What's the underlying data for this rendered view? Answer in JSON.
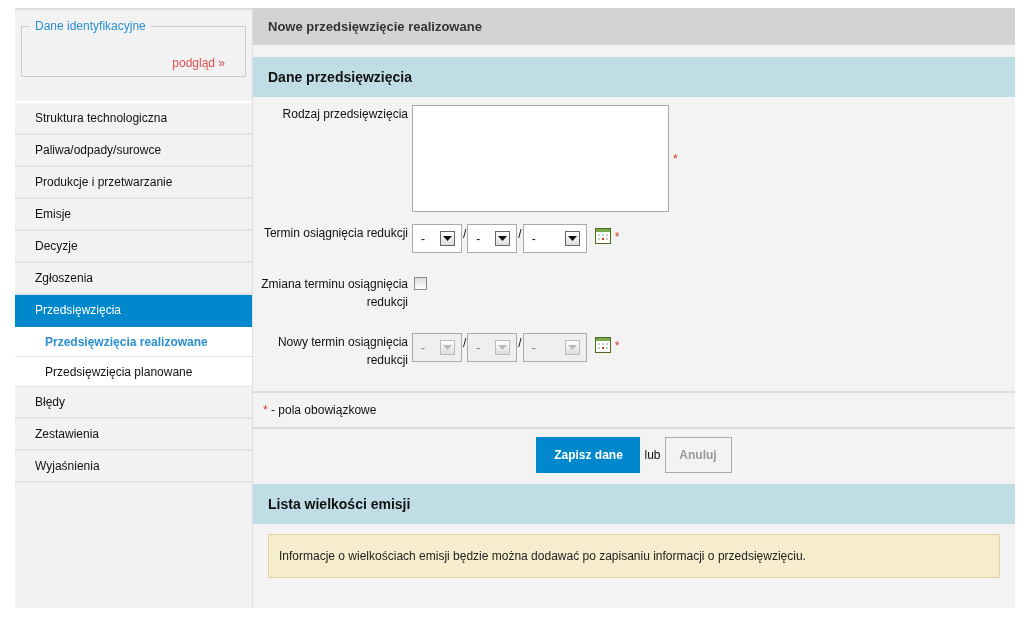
{
  "sidebar": {
    "fieldset": {
      "legend": "Dane identyfikacyjne",
      "link": "podgląd »"
    },
    "items": [
      {
        "label": "Struktura technologiczna",
        "selected": false
      },
      {
        "label": "Paliwa/odpady/surowce",
        "selected": false
      },
      {
        "label": "Produkcje i przetwarzanie",
        "selected": false
      },
      {
        "label": "Emisje",
        "selected": false
      },
      {
        "label": "Decyzje",
        "selected": false
      },
      {
        "label": "Zgłoszenia",
        "selected": false
      },
      {
        "label": "Przedsięwzięcia",
        "selected": true,
        "children": [
          {
            "label": "Przedsięwzięcia realizowane",
            "selected": true
          },
          {
            "label": "Przedsięwzięcia planowane",
            "selected": false
          }
        ]
      },
      {
        "label": "Błędy",
        "selected": false
      },
      {
        "label": "Zestawienia",
        "selected": false
      },
      {
        "label": "Wyjaśnienia",
        "selected": false
      }
    ]
  },
  "page_title": "Nowe przedsięwzięcie realizowane",
  "form_section": {
    "title": "Dane przedsięwzięcia",
    "fields": [
      {
        "kind": "textarea",
        "label": "Rodzaj przedsięwzięcia",
        "required_mark": "*"
      },
      {
        "kind": "date",
        "label": "Termin osiągnięcia redukcji",
        "disabled": false,
        "selects": [
          "-",
          "-",
          "-"
        ],
        "separators": [
          "/",
          "/"
        ],
        "required_mark": "*"
      },
      {
        "kind": "checkbox",
        "label": "Zmiana terminu osiągnięcia redukcji",
        "checked": false
      },
      {
        "kind": "date",
        "label": "Nowy termin osiągnięcia redukcji",
        "disabled": true,
        "selects": [
          "-",
          "-",
          "-"
        ],
        "separators": [
          "/",
          "/"
        ],
        "required_mark": "*"
      }
    ],
    "required_note": {
      "mark": "*",
      "text": "- pola obowiązkowe"
    },
    "save_button": "Zapisz dane",
    "or_text": "lub",
    "cancel_button": "Anuluj"
  },
  "emissions_section": {
    "title": "Lista wielkości emisji",
    "info": "Informacje o wielkościach emisji będzie można dodawać po zapisaniu informacji o przedsięwzięciu."
  }
}
